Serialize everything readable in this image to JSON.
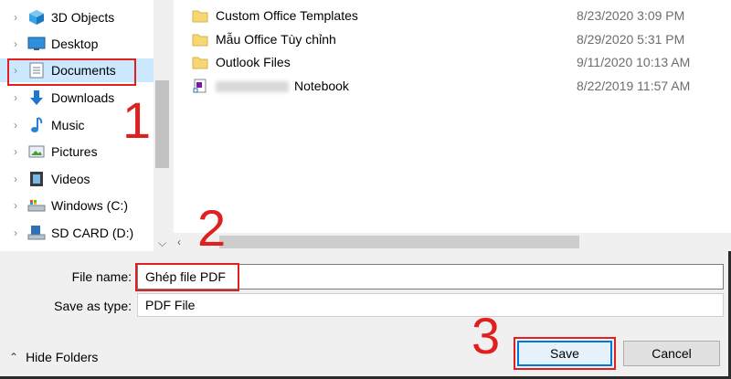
{
  "nav": {
    "items": [
      {
        "label": "3D Objects",
        "icon": "3d-objects-icon"
      },
      {
        "label": "Desktop",
        "icon": "desktop-icon"
      },
      {
        "label": "Documents",
        "icon": "documents-icon",
        "selected": true
      },
      {
        "label": "Downloads",
        "icon": "downloads-icon"
      },
      {
        "label": "Music",
        "icon": "music-icon"
      },
      {
        "label": "Pictures",
        "icon": "pictures-icon"
      },
      {
        "label": "Videos",
        "icon": "videos-icon"
      },
      {
        "label": "Windows (C:)",
        "icon": "drive-c-icon"
      },
      {
        "label": "SD CARD (D:)",
        "icon": "sd-card-icon"
      }
    ]
  },
  "files": [
    {
      "name": "Custom Office Templates",
      "date": "8/23/2020 3:09 PM",
      "icon": "folder-icon"
    },
    {
      "name": "Mẫu Office Tùy chỉnh",
      "date": "8/29/2020 5:31 PM",
      "icon": "folder-icon"
    },
    {
      "name": "Outlook Files",
      "date": "9/11/2020 10:13 AM",
      "icon": "folder-icon"
    },
    {
      "name": "Notebook",
      "date": "8/22/2019 11:57 AM",
      "icon": "onenote-shortcut-icon"
    }
  ],
  "form": {
    "file_name_label": "File name:",
    "file_name_value": "Ghép file PDF",
    "save_type_label": "Save as type:",
    "save_type_value": "PDF File"
  },
  "footer": {
    "hide_folders_label": "Hide Folders",
    "save_label": "Save",
    "cancel_label": "Cancel"
  },
  "annotations": {
    "step1": "1",
    "step2": "2",
    "step3": "3",
    "color": "#e02020"
  },
  "colors": {
    "selection": "#cce8ff",
    "folder": "#f7d774",
    "accent": "#0078d7"
  }
}
